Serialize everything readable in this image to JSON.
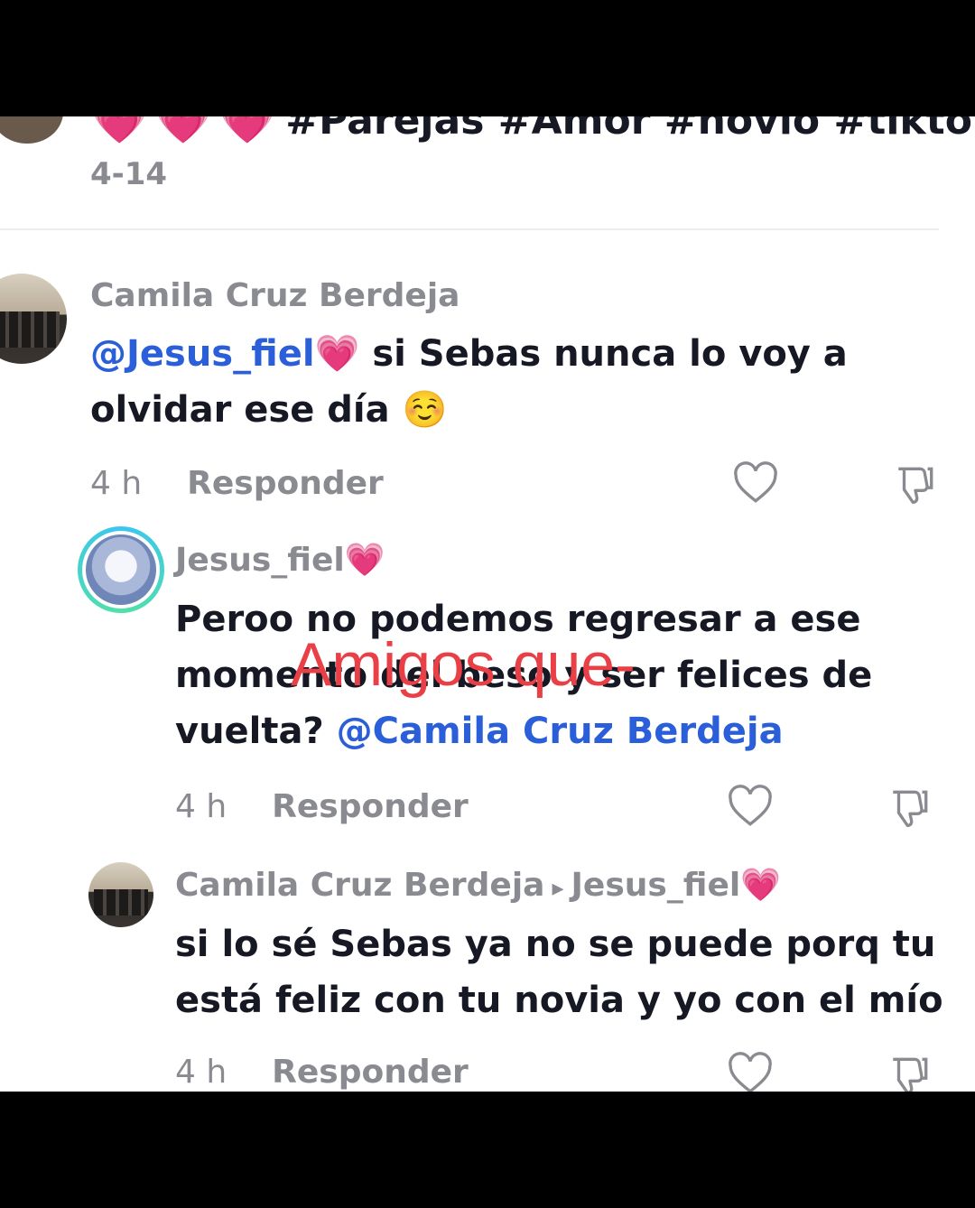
{
  "top_post": {
    "caption_emojis": [
      "💗",
      "💗",
      "💗"
    ],
    "caption": "#Parejas #Amor #novio #tiktok",
    "date": "4-14"
  },
  "comments": [
    {
      "author": "Camila Cruz Berdeja",
      "mention": "@Jesus_fiel💗",
      "text": " si Sebas nunca lo voy a olvidar ese día ☺️",
      "time": "4 h",
      "reply_label": "Responder"
    },
    {
      "author": "Jesus_fiel💗",
      "text": "Peroo no podemos regresar a ese momento del beso y ser felices de vuelta? ",
      "mention": "@Camila Cruz Berdeja",
      "time": "4 h",
      "reply_label": "Responder"
    },
    {
      "author": "Camila Cruz Berdeja",
      "reply_to": "Jesus_fiel💗",
      "text": "si lo sé Sebas ya no se puede porq tu está feliz con tu novia y yo con el mío",
      "time": "4 h",
      "reply_label": "Responder"
    }
  ],
  "overlay": {
    "text": "Amigos que-",
    "color": "#e84046"
  },
  "icons": {
    "like": "heart-outline-icon",
    "dislike": "thumbs-down-icon"
  }
}
